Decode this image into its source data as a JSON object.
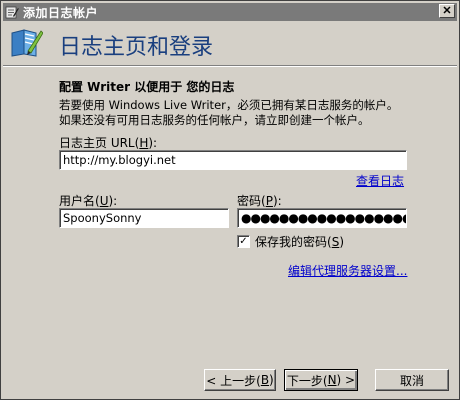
{
  "window": {
    "title": "添加日志帐户",
    "close_label": "✕"
  },
  "header": {
    "title": "日志主页和登录"
  },
  "section": {
    "title": "配置 Writer 以便用于 您的日志",
    "description": "若要使用 Windows Live Writer，必须已拥有某日志服务的帐户。如果还没有可用日志服务的任何帐户，请立即创建一个帐户。"
  },
  "homepage": {
    "label_prefix": "日志主页 URL(",
    "label_key": "H",
    "label_suffix": "):",
    "value": "http://my.blogyi.net",
    "view_link": "查看日志"
  },
  "username": {
    "label_prefix": "用户名(",
    "label_key": "U",
    "label_suffix": "):",
    "value": "SpoonySonny"
  },
  "password": {
    "label_prefix": "密码(",
    "label_key": "P",
    "label_suffix": "):",
    "value": "●●●●●●●●●●●●●●●●●●●●"
  },
  "remember": {
    "label_prefix": "保存我的密码(",
    "label_key": "S",
    "label_suffix": ")",
    "checked": true,
    "check_glyph": "✓"
  },
  "proxy_link": "编辑代理服务器设置...",
  "buttons": {
    "back_prefix": "< 上一步(",
    "back_key": "B",
    "back_suffix": ")",
    "next_prefix": "下一步(",
    "next_key": "N",
    "next_suffix": ") >",
    "cancel": "取消"
  },
  "colors": {
    "titlebar": "#7a7a7a",
    "header_title": "#1a3f7f",
    "link": "#0000cc",
    "dialog_bg": "#d4d0c8"
  },
  "icons": {
    "title": "writer-app-icon",
    "header": "writer-app-icon",
    "close": "close-icon",
    "checkbox": "check-icon"
  }
}
